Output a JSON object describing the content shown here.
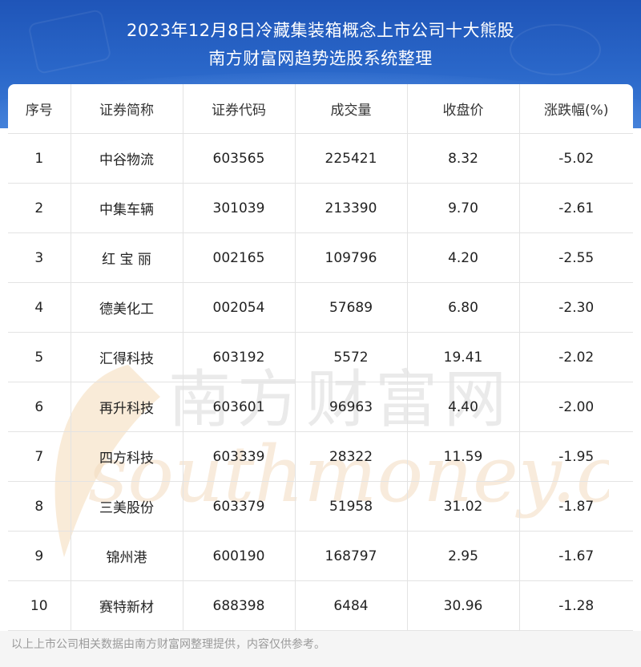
{
  "header": {
    "title_line1": "2023年12月8日冷藏集装箱概念上市公司十大熊股",
    "title_line2": "南方财富网趋势选股系统整理"
  },
  "table": {
    "columns": [
      "序号",
      "证券简称",
      "证券代码",
      "成交量",
      "收盘价",
      "涨跌幅(%)"
    ],
    "rows": [
      [
        "1",
        "中谷物流",
        "603565",
        "225421",
        "8.32",
        "-5.02"
      ],
      [
        "2",
        "中集车辆",
        "301039",
        "213390",
        "9.70",
        "-2.61"
      ],
      [
        "3",
        "红 宝 丽",
        "002165",
        "109796",
        "4.20",
        "-2.55"
      ],
      [
        "4",
        "德美化工",
        "002054",
        "57689",
        "6.80",
        "-2.30"
      ],
      [
        "5",
        "汇得科技",
        "603192",
        "5572",
        "19.41",
        "-2.02"
      ],
      [
        "6",
        "再升科技",
        "603601",
        "96963",
        "4.40",
        "-2.00"
      ],
      [
        "7",
        "四方科技",
        "603339",
        "28322",
        "11.59",
        "-1.95"
      ],
      [
        "8",
        "三美股份",
        "603379",
        "51958",
        "31.02",
        "-1.87"
      ],
      [
        "9",
        "锦州港",
        "600190",
        "168797",
        "2.95",
        "-1.67"
      ],
      [
        "10",
        "赛特新材",
        "688398",
        "6484",
        "30.96",
        "-1.28"
      ]
    ]
  },
  "watermark": {
    "cn_text": "南方财富网",
    "en_text": "southmoney.com"
  },
  "footer": {
    "note": "以上上市公司相关数据由南方财富网整理提供，内容仅供参考。"
  }
}
